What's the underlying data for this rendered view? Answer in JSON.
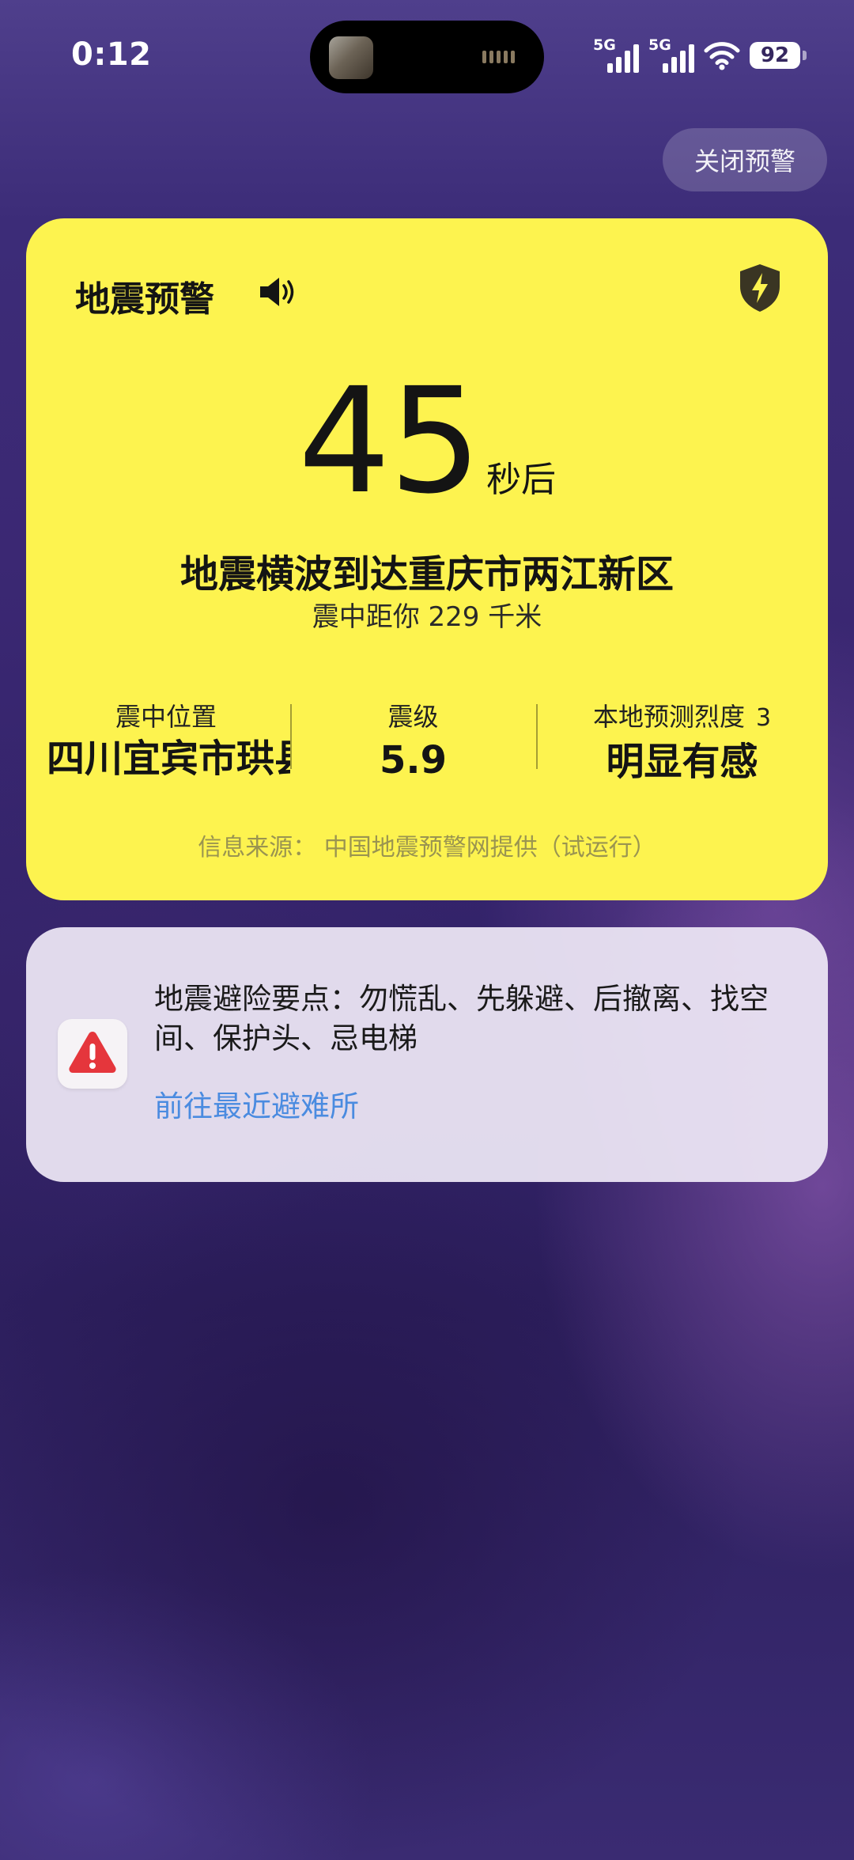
{
  "status_bar": {
    "time": "0:12",
    "network_1": "5G",
    "network_2": "5G",
    "battery": "92",
    "wifi_icon": "wifi-icon"
  },
  "close_button": {
    "label": "关闭预警"
  },
  "alert": {
    "title": "地震预警",
    "speaker_icon": "speaker-icon",
    "shield_icon": "shield-bolt-icon",
    "countdown": "45",
    "countdown_unit": "秒后",
    "wave_message": "地震横波到达重庆市两江新区",
    "distance": "震中距你 229 千米",
    "epicenter_label": "震中位置",
    "epicenter_value": "四川宜宾市珙县",
    "magnitude_label": "震级",
    "magnitude_value": "5.9",
    "intensity_label": "本地预测烈度",
    "intensity_number": "3",
    "intensity_value": "明显有感",
    "source": "信息来源： 中国地震预警网提供（试运行）",
    "colors": {
      "card_bg": "#fdf34f",
      "source_text": "#9a9450"
    }
  },
  "tips": {
    "icon": "warning-triangle-icon",
    "text": "地震避险要点：勿慌乱、先躲避、后撤离、找空间、保护头、忌电梯",
    "link": "前往最近避难所",
    "colors": {
      "link": "#4a8be0",
      "icon": "#e5363c"
    }
  }
}
